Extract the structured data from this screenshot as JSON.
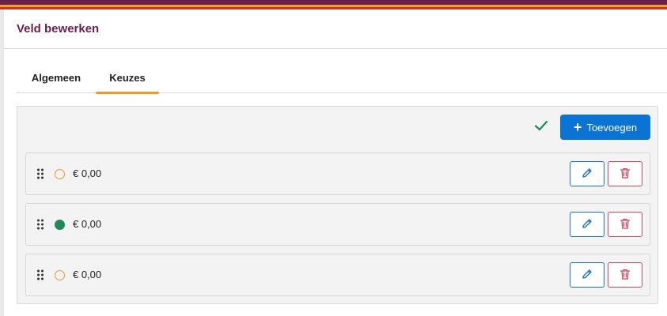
{
  "dialog": {
    "title": "Veld bewerken"
  },
  "tabs": [
    {
      "label": "Algemeen",
      "active": false
    },
    {
      "label": "Keuzes",
      "active": true
    }
  ],
  "toolbar": {
    "add_label": "Toevoegen",
    "status_icon": "check-icon"
  },
  "choices": [
    {
      "price": "€ 0,00",
      "default": false
    },
    {
      "price": "€ 0,00",
      "default": true
    },
    {
      "price": "€ 0,00",
      "default": false
    }
  ],
  "colors": {
    "brand": "#6b1f4c",
    "accent": "#f29a1f",
    "primary": "#0a74d4",
    "success": "#1f8a55",
    "danger": "#d6455a"
  }
}
